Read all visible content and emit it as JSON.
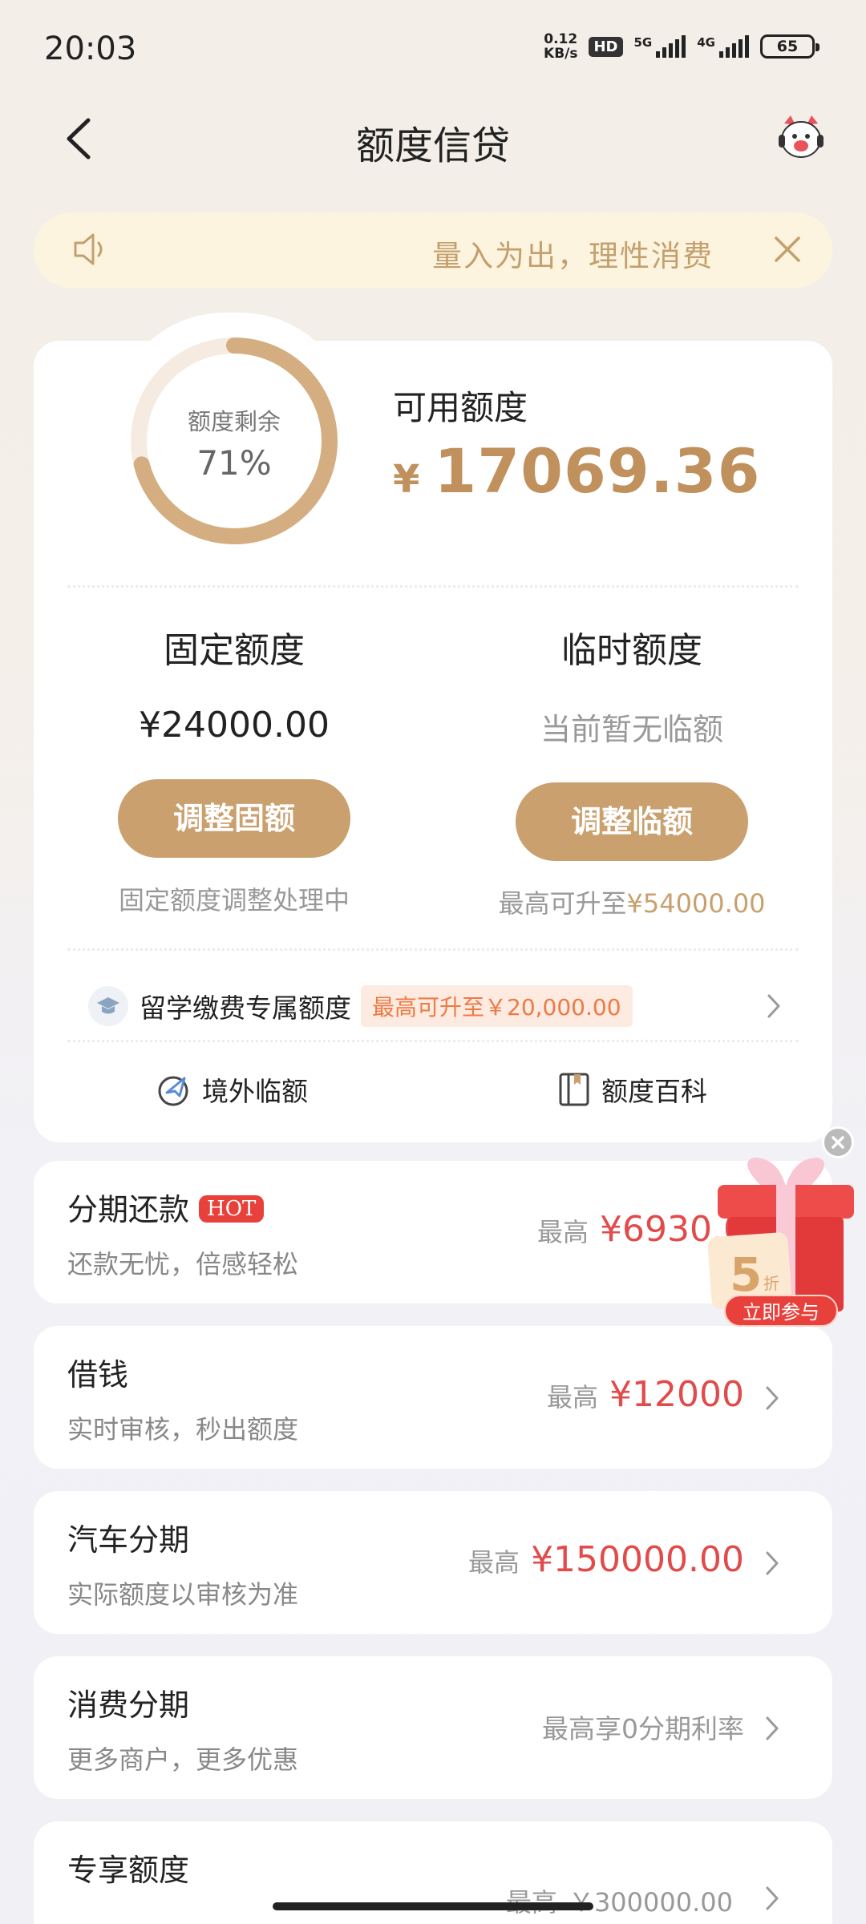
{
  "status": {
    "time": "20:03",
    "speed_top": "0.12",
    "speed_unit": "KB/s",
    "hd_label": "HD",
    "net1": "5G",
    "net2": "4G",
    "battery": "65"
  },
  "header": {
    "title": "额度信贷"
  },
  "notice": {
    "text": "量入为出，理性消费"
  },
  "quota": {
    "ring_label": "额度剩余",
    "ring_value": "71%",
    "remaining_fraction": 0.71,
    "available_label": "可用额度",
    "currency": "¥",
    "available_amount": "17069.36"
  },
  "fixed": {
    "title": "固定额度",
    "value": "¥24000.00",
    "button": "调整固额",
    "note": "固定额度调整处理中"
  },
  "temp": {
    "title": "临时额度",
    "value": "当前暂无临额",
    "button": "调整临额",
    "note_prefix": "最高可升至",
    "note_amount": "¥54000.00"
  },
  "study": {
    "label": "留学缴费专属额度",
    "badge": "最高可升至￥20,000.00"
  },
  "links": {
    "overseas": "境外临额",
    "wiki": "额度百科"
  },
  "products": [
    {
      "title": "分期还款",
      "tag": "HOT",
      "subtitle": "还款无忧，倍感轻松",
      "prefix": "最高",
      "amount": "¥6930.00"
    },
    {
      "title": "借钱",
      "subtitle": "实时审核，秒出额度",
      "prefix": "最高",
      "amount": "¥12000"
    },
    {
      "title": "汽车分期",
      "subtitle": "实际额度以审核为准",
      "prefix": "最高",
      "amount": "¥150000.00"
    },
    {
      "title": "消费分期",
      "subtitle": "更多商户，更多优惠",
      "plain": "最高享0分期利率"
    },
    {
      "title": "专享额度",
      "prefix": "最高",
      "amount": "￥300000.00"
    }
  ],
  "promo": {
    "discount": "5",
    "discount_unit": "折",
    "cta": "立即参与"
  },
  "colors": {
    "gold": "#c9a06e",
    "red": "#e24b4b",
    "notice_bg": "#fdf4df"
  }
}
